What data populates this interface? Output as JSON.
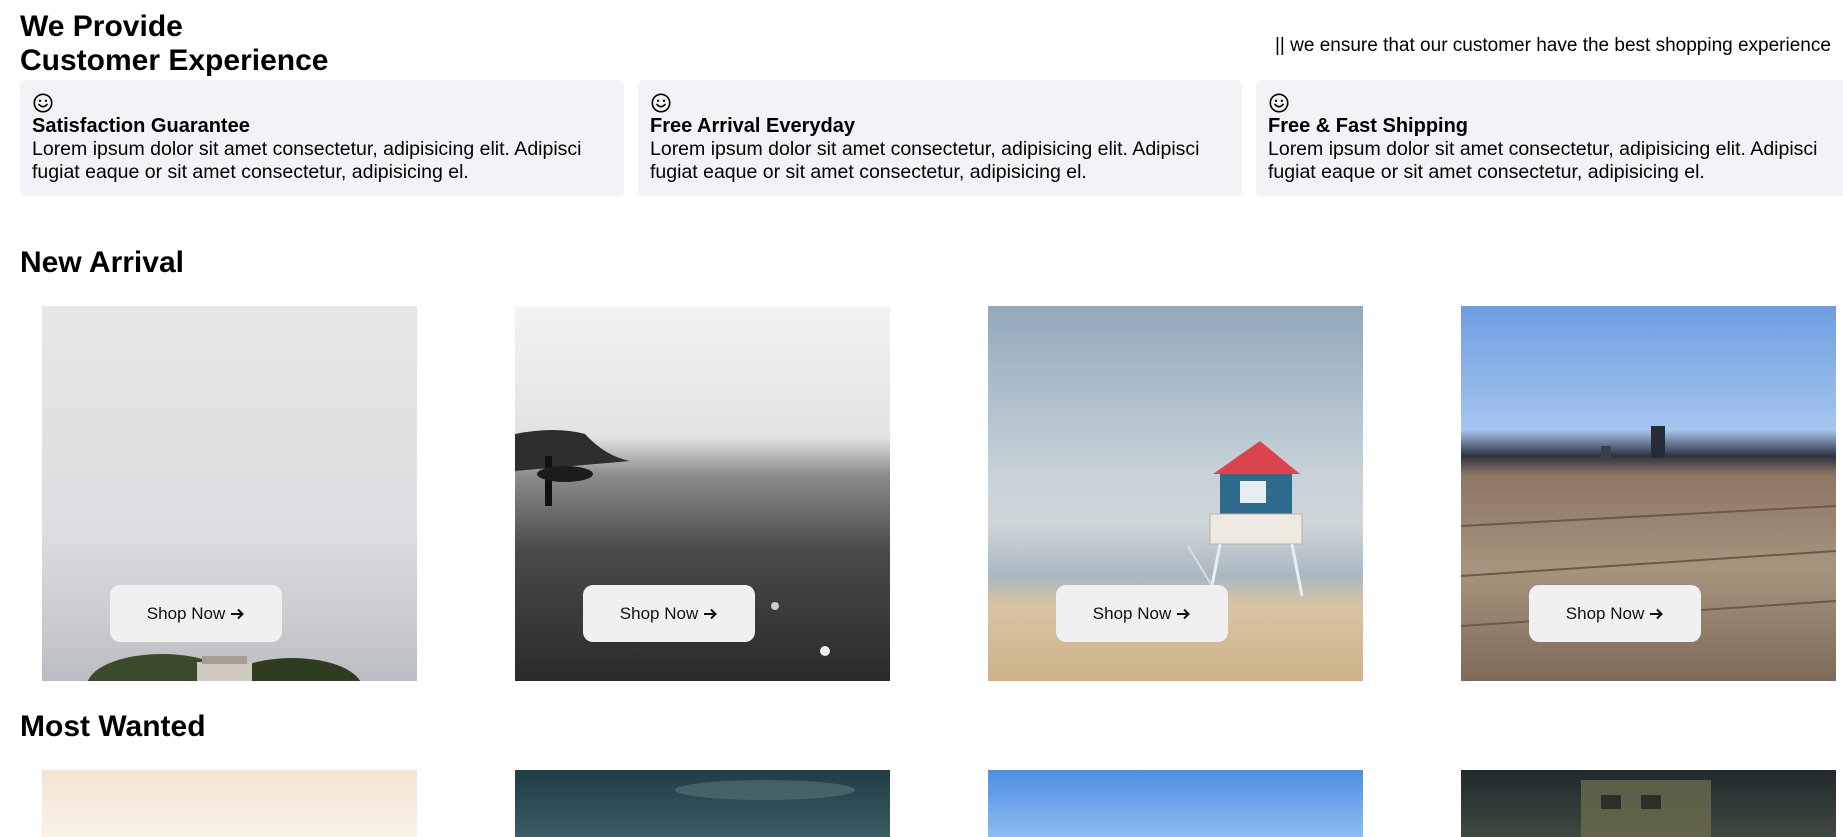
{
  "hero": {
    "title_line1": "We Provide",
    "title_line2": "Customer Experience",
    "tagline": "|| we ensure that our customer have the best shopping experience"
  },
  "features": [
    {
      "icon": "smile-icon",
      "title": "Satisfaction Guarantee",
      "description": "Lorem ipsum dolor sit amet consectetur, adipisicing elit. Adipisci fugiat eaque or sit amet consectetur, adipisicing el."
    },
    {
      "icon": "smile-icon",
      "title": "Free Arrival Everyday",
      "description": "Lorem ipsum dolor sit amet consectetur, adipisicing elit. Adipisci fugiat eaque or sit amet consectetur, adipisicing el."
    },
    {
      "icon": "smile-icon",
      "title": "Free & Fast Shipping",
      "description": "Lorem ipsum dolor sit amet consectetur, adipisicing elit. Adipisci fugiat eaque or sit amet consectetur, adipisicing el."
    }
  ],
  "new_arrival": {
    "title": "New Arrival",
    "products": [
      {
        "image": "overcast-sky-with-trees-and-house",
        "button_label": "Shop Now",
        "button_icon": "arrow-right-icon"
      },
      {
        "image": "black-and-white-beach-with-surfer",
        "button_label": "Shop Now",
        "button_icon": "arrow-right-icon"
      },
      {
        "image": "lifeguard-tower-on-beach",
        "button_label": "Shop Now",
        "button_icon": "arrow-right-icon"
      },
      {
        "image": "wooden-boardwalk-blue-sky",
        "button_label": "Shop Now",
        "button_icon": "arrow-right-icon"
      }
    ]
  },
  "most_wanted": {
    "title": "Most Wanted",
    "products": [
      {
        "image": "bright-hazy-photo"
      },
      {
        "image": "teal-night-sky-photo"
      },
      {
        "image": "clear-blue-sky-photo"
      },
      {
        "image": "dark-building-photo"
      }
    ]
  }
}
